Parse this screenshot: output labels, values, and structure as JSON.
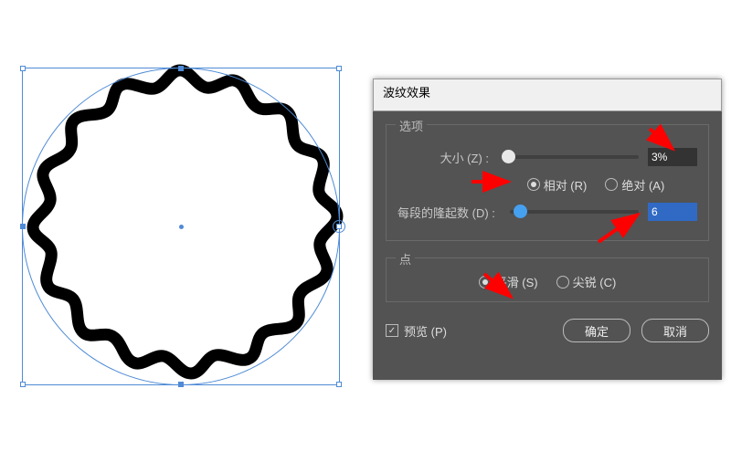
{
  "dialog": {
    "title": "波纹效果",
    "options_legend": "选项",
    "size_label": "大小 (Z) :",
    "size_value": "3%",
    "relative_label": "相对 (R)",
    "absolute_label": "绝对 (A)",
    "ridges_label": "每段的隆起数 (D) :",
    "ridges_value": "6",
    "point_legend": "点",
    "smooth_label": "平滑 (S)",
    "corner_label": "尖锐 (C)",
    "preview_label": "预览 (P)",
    "ok_label": "确定",
    "cancel_label": "取消"
  },
  "radio_state": {
    "size_mode": "relative",
    "point_mode": "smooth",
    "preview_checked": true
  },
  "chart_data": {
    "type": "other",
    "description": "Circle shape on canvas with Zig-Zag/Wave effect preview applied",
    "ridges_per_segment": 6,
    "segments": 4,
    "total_waves": 24,
    "size_percent": 3,
    "point_style": "smooth"
  }
}
